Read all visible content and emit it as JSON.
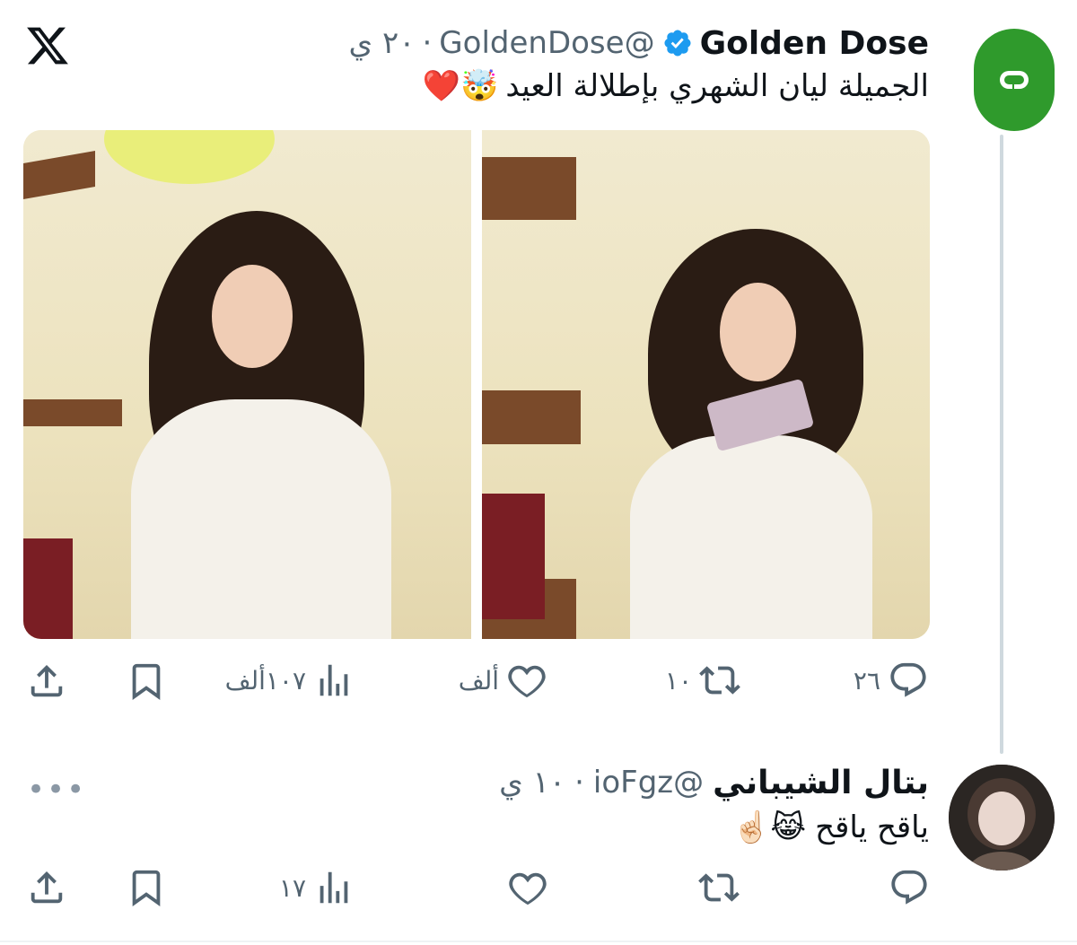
{
  "tweet": {
    "name": "Golden Dose",
    "handle": "@GoldenDose",
    "time": "٢٠ ي",
    "text": "الجميلة ليان الشهري بإطلالة العيد",
    "emoji": "🤯❤️",
    "stats": {
      "replies": "٢٦",
      "retweets": "١٠",
      "likes": "ألف",
      "views": "١٠٧ألف"
    }
  },
  "reply": {
    "name": "بتال الشيباني",
    "handle": "@ioFgz",
    "time": "١٠ ي",
    "text": "ياقح ياقح",
    "emoji": "😹☝🏻",
    "stats": {
      "views": "١٧"
    }
  },
  "colors": {
    "accent": "#1d9bf0",
    "muted": "#536471",
    "avatar_green": "#2f9a2c"
  }
}
